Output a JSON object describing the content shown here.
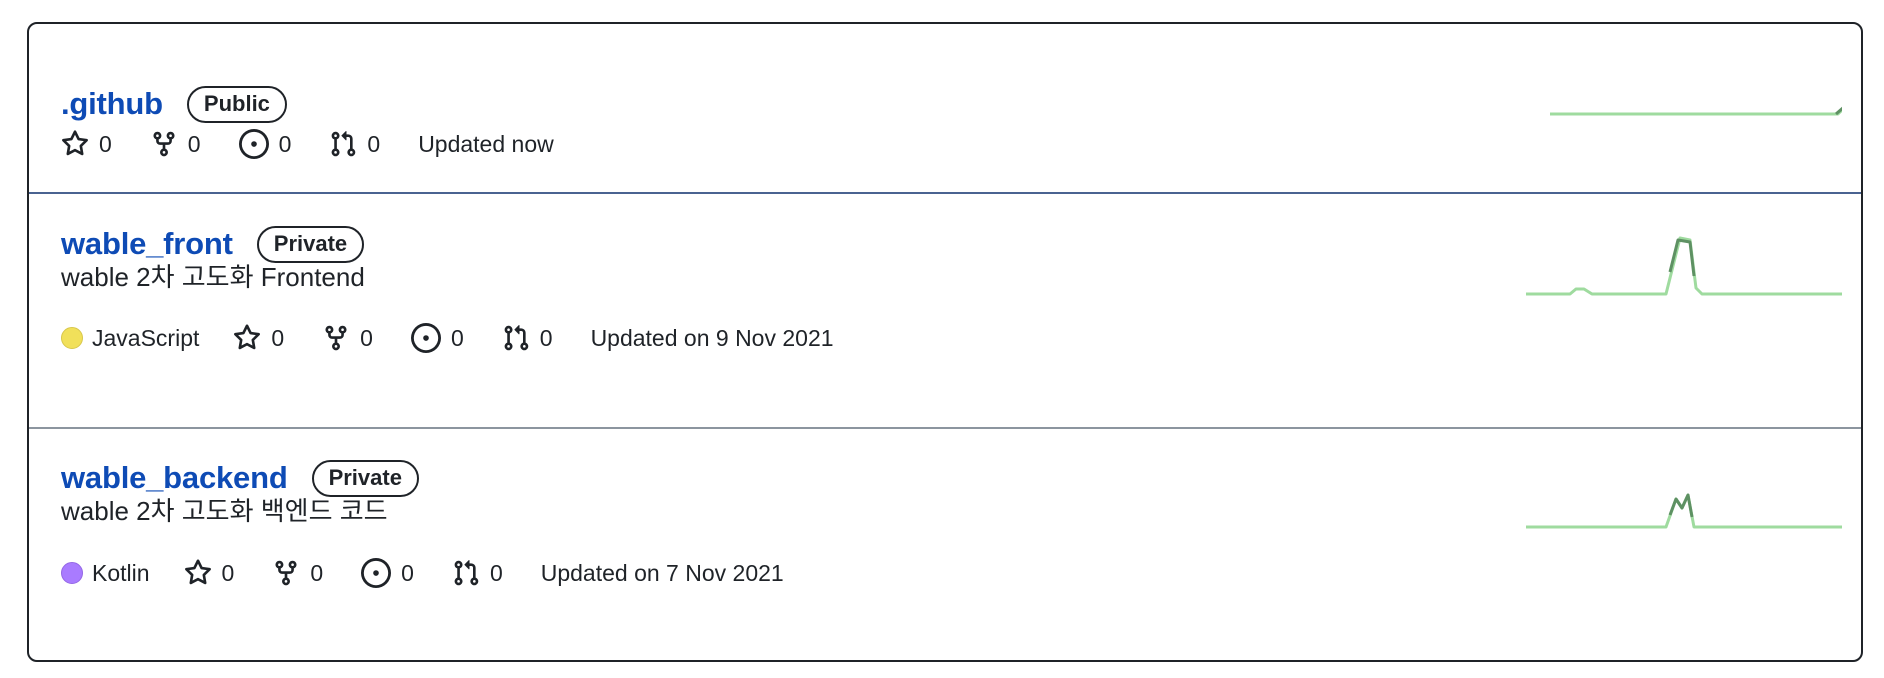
{
  "repos": [
    {
      "name": ".github",
      "visibility": "Public",
      "description": "",
      "language": "",
      "stars": "0",
      "forks": "0",
      "issues": "0",
      "pulls": "0",
      "updated": "Updated now"
    },
    {
      "name": "wable_front",
      "visibility": "Private",
      "description": "wable 2차 고도화 Frontend",
      "language": "JavaScript",
      "language_color": "#f1e05a",
      "stars": "0",
      "forks": "0",
      "issues": "0",
      "pulls": "0",
      "updated": "Updated on 9 Nov 2021"
    },
    {
      "name": "wable_backend",
      "visibility": "Private",
      "description": "wable 2차 고도화 백엔드 코드",
      "language": "Kotlin",
      "language_color": "#a97bff",
      "stars": "0",
      "forks": "0",
      "issues": "0",
      "pulls": "0",
      "updated": "Updated on 7 Nov 2021"
    }
  ],
  "icons": {
    "star": "star-icon",
    "fork": "fork-icon",
    "issue": "issue-icon",
    "pull": "pull-request-icon"
  },
  "colors": {
    "link": "#0e4bb5",
    "sparkline_light": "#9fdb9f",
    "sparkline_dark": "#5e9163"
  }
}
